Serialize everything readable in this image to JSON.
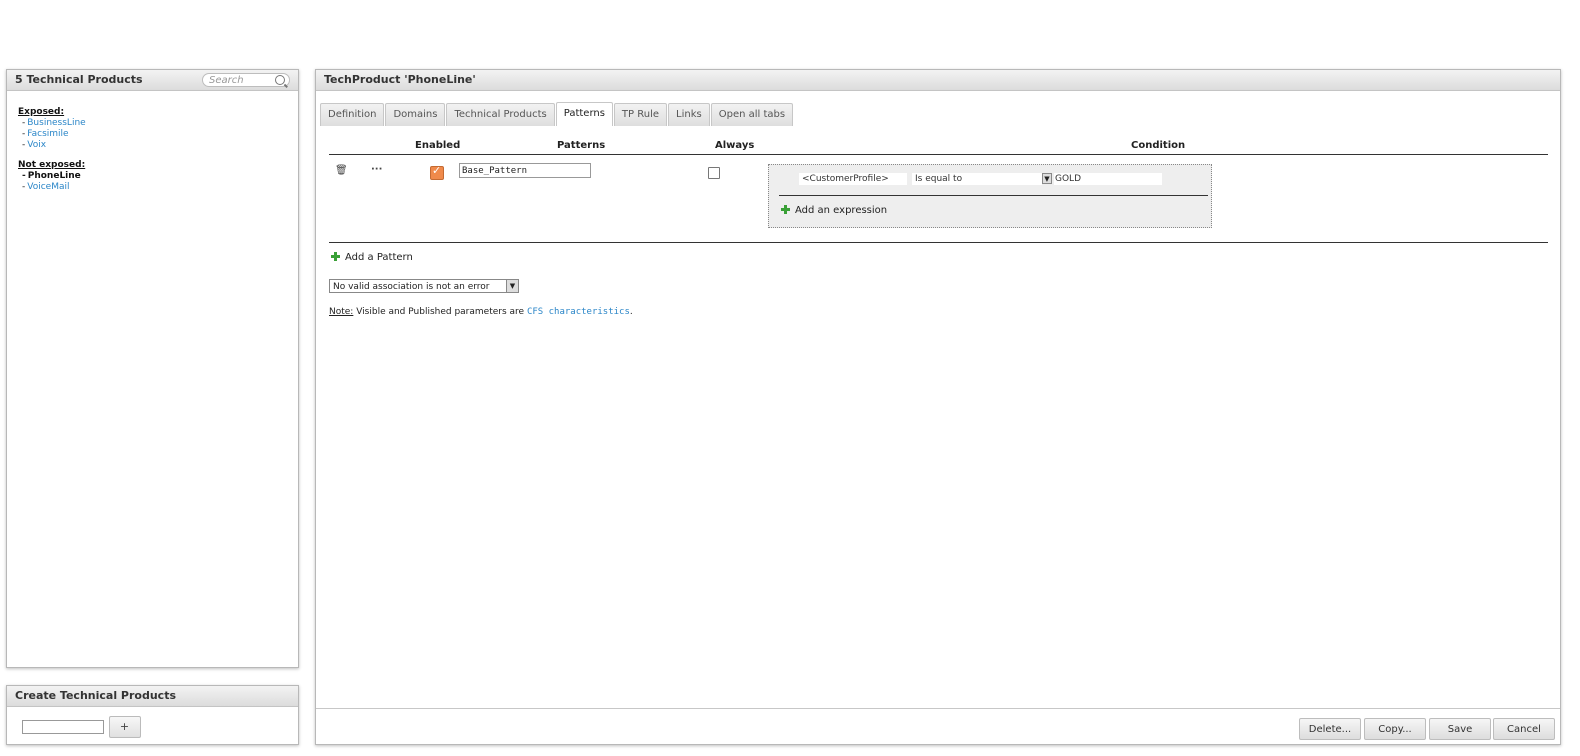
{
  "left_panel": {
    "title": "5 Technical Products",
    "search_placeholder": "Search",
    "exposed_title": "Exposed:",
    "exposed_items": [
      "BusinessLine",
      "Facsimile",
      "Voix"
    ],
    "not_exposed_title": "Not exposed:",
    "not_exposed_items": [
      "PhoneLine",
      "VoiceMail"
    ]
  },
  "create_panel": {
    "title": "Create Technical Products",
    "input_value": "",
    "add_label": "+"
  },
  "main_panel": {
    "title": "TechProduct 'PhoneLine'",
    "tabs": [
      "Definition",
      "Domains",
      "Technical Products",
      "Patterns",
      "TP Rule",
      "Links",
      "Open all tabs"
    ],
    "active_tab": "Patterns",
    "columns": {
      "enabled": "Enabled",
      "patterns": "Patterns",
      "always": "Always",
      "condition": "Condition"
    },
    "rows": [
      {
        "delete_glyph": "🗑",
        "menu_glyph": "···",
        "enabled": true,
        "pattern": "Base_Pattern",
        "always": false,
        "condition": {
          "field": "<CustomerProfile>",
          "operator": "Is equal to",
          "value": "GOLD"
        }
      }
    ],
    "add_expression": "Add an expression",
    "add_pattern": "Add a Pattern",
    "association_select": "No valid association is not an error",
    "note_label": "Note:",
    "note_text": " Visible and Published parameters are ",
    "note_link": "CFS characteristics",
    "note_end": ".",
    "buttons": {
      "delete": "Delete...",
      "copy": "Copy...",
      "save": "Save",
      "cancel": "Cancel"
    },
    "accent_color": "#2b86c8",
    "check_color": "#f08a4b"
  }
}
